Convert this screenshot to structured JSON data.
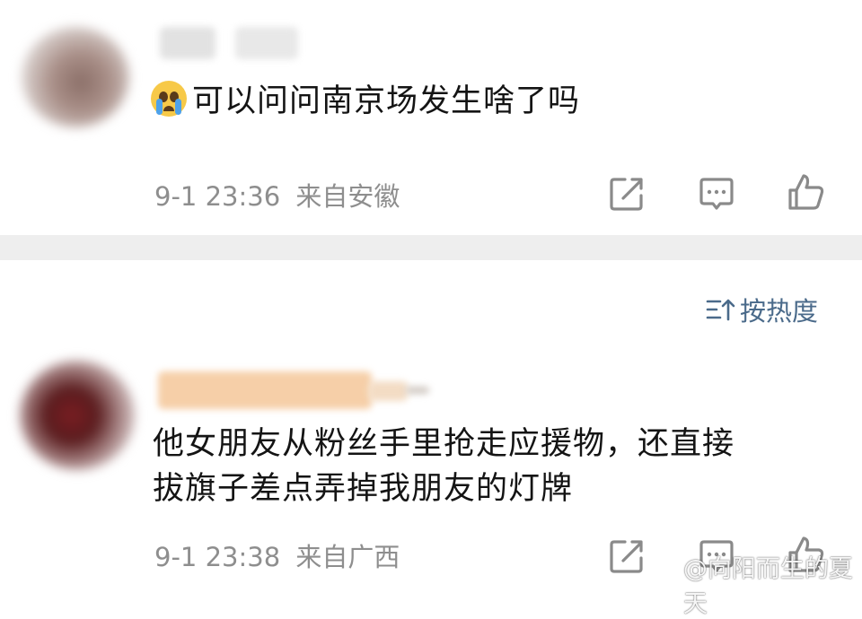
{
  "comments": [
    {
      "emoji": "crying-face-icon",
      "text": "可以问问南京场发生啥了吗",
      "date": "9-1 23:36",
      "location": "来自安徽"
    },
    {
      "text_line1": "他女朋友从粉丝手里抢走应援物，还直接",
      "text_line2": "拔旗子差点弄掉我朋友的灯牌",
      "date": "9-1 23:38",
      "location": "来自广西"
    }
  ],
  "sort": {
    "label": "按热度"
  },
  "watermark": {
    "text": "@向阳而生的夏天"
  },
  "colors": {
    "meta": "#8e8e8e",
    "sort": "#4a6a8a",
    "text": "#141414",
    "divider": "#eeeeee"
  }
}
